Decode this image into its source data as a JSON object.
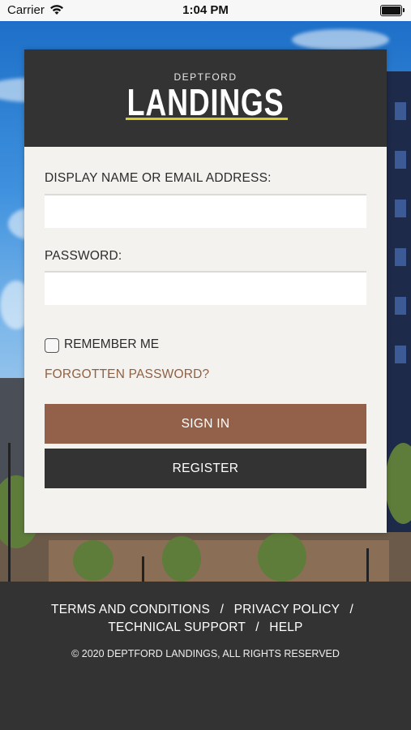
{
  "status_bar": {
    "carrier": "Carrier",
    "time": "1:04 PM"
  },
  "brand": {
    "small": "DEPTFORD",
    "big": "LANDINGS",
    "accent": "#d6cc2e"
  },
  "form": {
    "username_label": "DISPLAY NAME OR EMAIL ADDRESS:",
    "username_value": "",
    "password_label": "PASSWORD:",
    "password_value": "",
    "remember_label": "REMEMBER ME",
    "remember_checked": false,
    "forgot_label": "FORGOTTEN PASSWORD?",
    "signin_label": "SIGN IN",
    "register_label": "REGISTER"
  },
  "footer": {
    "links": [
      "TERMS AND CONDITIONS",
      "PRIVACY POLICY",
      "TECHNICAL SUPPORT",
      "HELP"
    ],
    "separator": "/",
    "copyright": "© 2020 DEPTFORD LANDINGS, ALL RIGHTS RESERVED"
  },
  "colors": {
    "signin_button": "#936149",
    "register_button": "#333333",
    "forgot_link": "#8f6144",
    "card_header": "#333333",
    "footer_bg": "#333333"
  }
}
